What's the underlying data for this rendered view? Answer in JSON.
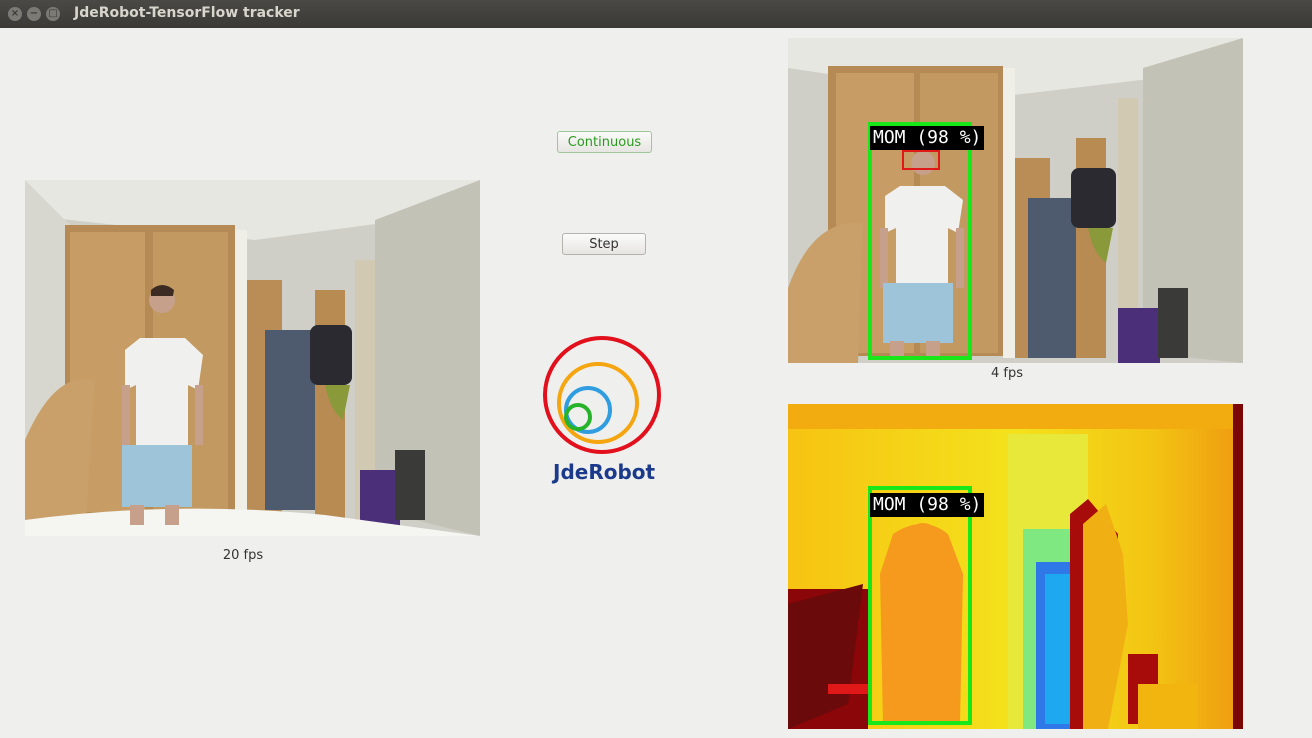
{
  "window": {
    "title": "JdeRobot-TensorFlow tracker",
    "close_glyph": "×",
    "minimize_glyph": "−",
    "maximize_glyph": "□"
  },
  "left_camera": {
    "fps_label": "20 fps"
  },
  "controls": {
    "continuous_label": "Continuous",
    "step_label": "Step"
  },
  "logo": {
    "text": "JdeRobot",
    "ring_colors": [
      "#e2101c",
      "#f5a50f",
      "#2f9de0",
      "#26b32a"
    ]
  },
  "rgb_detection": {
    "label": "MOM (98 %)",
    "fps_label": "4 fps",
    "box_color": "#18e81a"
  },
  "depth_detection": {
    "label": "MOM (98 %)",
    "box_color": "#18e81a"
  },
  "icons": [
    "close-icon",
    "minimize-icon",
    "maximize-icon"
  ]
}
